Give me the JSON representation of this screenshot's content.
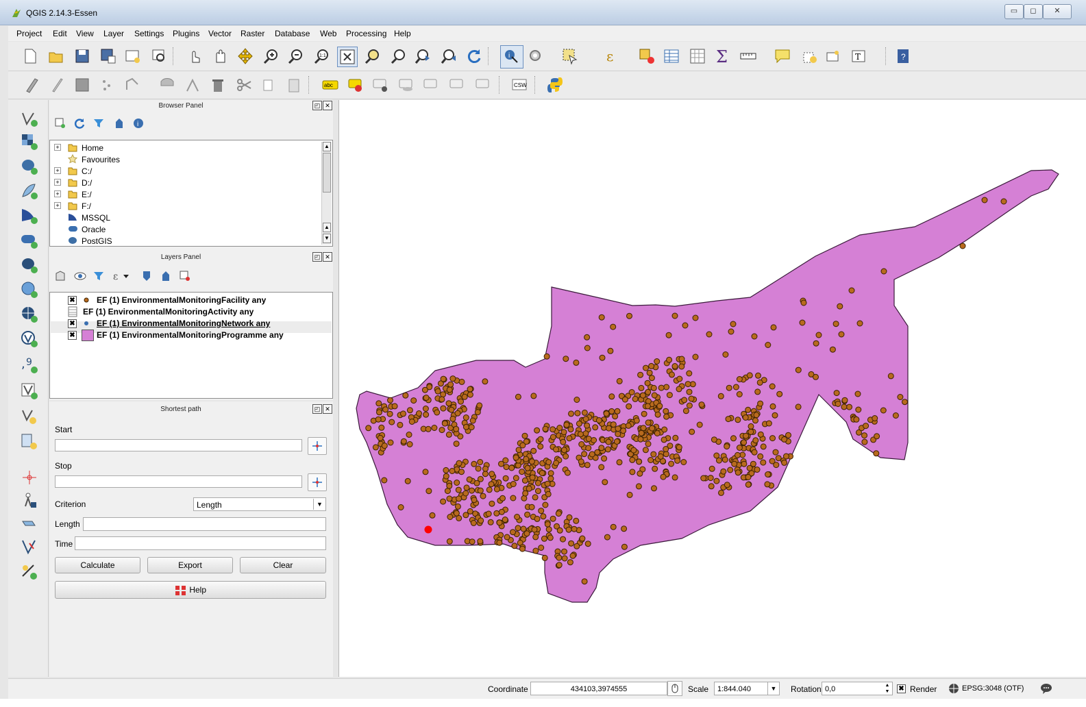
{
  "window": {
    "title": "QGIS 2.14.3-Essen",
    "minimize": "▭",
    "maximize": "◻",
    "close": "✕"
  },
  "menu": [
    "Project",
    "Edit",
    "View",
    "Layer",
    "Settings",
    "Plugins",
    "Vector",
    "Raster",
    "Database",
    "Web",
    "Processing",
    "Help"
  ],
  "browser_panel": {
    "title": "Browser Panel",
    "items": [
      "Home",
      "Favourites",
      "C:/",
      "D:/",
      "E:/",
      "F:/",
      "MSSQL",
      "Oracle",
      "PostGIS"
    ]
  },
  "layers_panel": {
    "title": "Layers Panel",
    "layers": [
      {
        "label": "EF (1) EnvironmentalMonitoringFacility any",
        "checked": true
      },
      {
        "label": "EF (1) EnvironmentalMonitoringActivity any",
        "checked": false
      },
      {
        "label": "EF (1) EnvironmentalMonitoringNetwork any",
        "checked": true
      },
      {
        "label": "EF (1) EnvironmentalMonitoringProgramme any",
        "checked": true
      }
    ]
  },
  "shortest_path": {
    "title": "Shortest path",
    "start_label": "Start",
    "stop_label": "Stop",
    "criterion_label": "Criterion",
    "criterion_value": "Length",
    "length_label": "Length",
    "time_label": "Time",
    "calculate": "Calculate",
    "export": "Export",
    "clear": "Clear",
    "help": "Help"
  },
  "status": {
    "coordinate_label": "Coordinate",
    "coordinate_value": "434103,3974555",
    "scale_label": "Scale",
    "scale_value": "1:844.040",
    "rotation_label": "Rotation",
    "rotation_value": "0,0",
    "render_label": "Render",
    "crs": "EPSG:3048 (OTF)"
  },
  "colors": {
    "polygon_fill": "#d580d5",
    "polygon_stroke": "#3b1a3b",
    "point_fill": "#b86a1e",
    "point_stroke": "#3b2000",
    "highlight_point": "#ff0000"
  }
}
